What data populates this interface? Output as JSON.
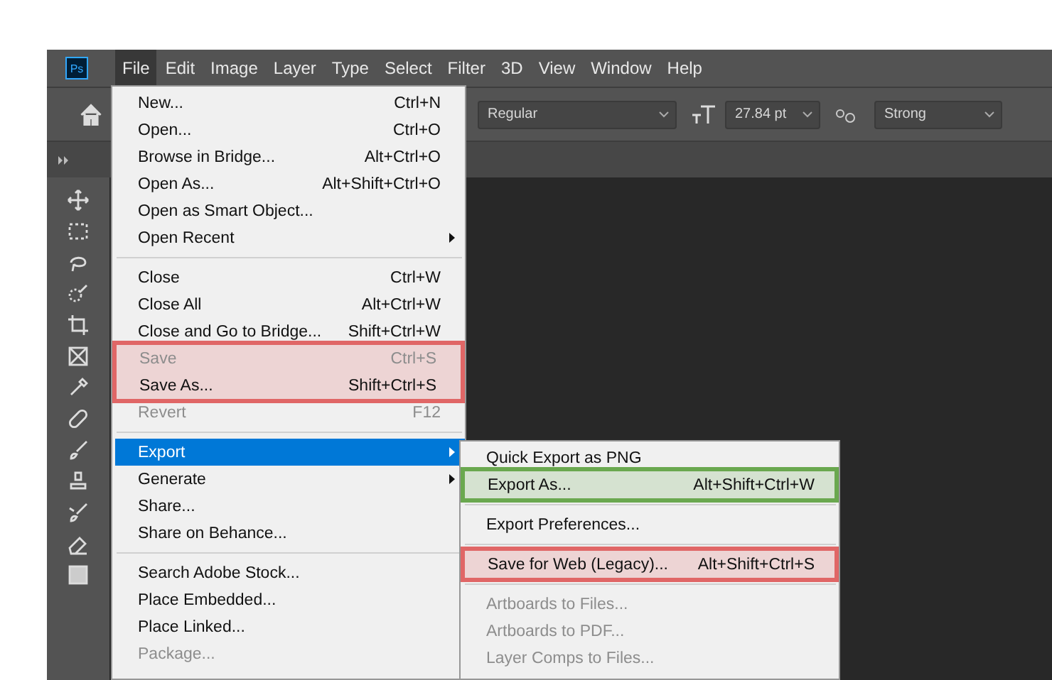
{
  "app": {
    "logo": "Ps"
  },
  "menu_bar": [
    {
      "label": "File",
      "selected": true
    },
    {
      "label": "Edit",
      "selected": false
    },
    {
      "label": "Image",
      "selected": false
    },
    {
      "label": "Layer",
      "selected": false
    },
    {
      "label": "Type",
      "selected": false
    },
    {
      "label": "Select",
      "selected": false
    },
    {
      "label": "Filter",
      "selected": false
    },
    {
      "label": "3D",
      "selected": false
    },
    {
      "label": "View",
      "selected": false
    },
    {
      "label": "Window",
      "selected": false
    },
    {
      "label": "Help",
      "selected": false
    }
  ],
  "options_bar": {
    "font_style": "Regular",
    "font_size": "27.84 pt",
    "anti_alias": "Strong"
  },
  "file_menu": {
    "sections": [
      {
        "items": [
          {
            "label": "New...",
            "shortcut": "Ctrl+N",
            "disabled": false,
            "selected": false,
            "submenu": false
          },
          {
            "label": "Open...",
            "shortcut": "Ctrl+O",
            "disabled": false,
            "selected": false,
            "submenu": false
          },
          {
            "label": "Browse in Bridge...",
            "shortcut": "Alt+Ctrl+O",
            "disabled": false,
            "selected": false,
            "submenu": false
          },
          {
            "label": "Open As...",
            "shortcut": "Alt+Shift+Ctrl+O",
            "disabled": false,
            "selected": false,
            "submenu": false
          },
          {
            "label": "Open as Smart Object...",
            "disabled": false,
            "selected": false,
            "submenu": false
          },
          {
            "label": "Open Recent",
            "disabled": false,
            "selected": false,
            "submenu": true
          }
        ]
      },
      {
        "items": [
          {
            "label": "Close",
            "shortcut": "Ctrl+W",
            "disabled": false,
            "selected": false,
            "submenu": false
          },
          {
            "label": "Close All",
            "shortcut": "Alt+Ctrl+W",
            "disabled": false,
            "selected": false,
            "submenu": false
          },
          {
            "label": "Close and Go to Bridge...",
            "shortcut": "Shift+Ctrl+W",
            "disabled": false,
            "selected": false,
            "submenu": false
          },
          {
            "label": "Save",
            "shortcut": "Ctrl+S",
            "disabled": true,
            "selected": false,
            "submenu": false,
            "color": "#e06666"
          },
          {
            "label": "Save As...",
            "shortcut": "Shift+Ctrl+S",
            "disabled": false,
            "selected": false,
            "submenu": false,
            "color": "#e06666"
          },
          {
            "label": "Revert",
            "shortcut": "F12",
            "disabled": true,
            "selected": false,
            "submenu": false
          }
        ]
      },
      {
        "items": [
          {
            "label": "Export",
            "disabled": false,
            "selected": true,
            "submenu": true
          },
          {
            "label": "Generate",
            "disabled": false,
            "selected": false,
            "submenu": true
          },
          {
            "label": "Share...",
            "disabled": false,
            "selected": false,
            "submenu": false
          },
          {
            "label": "Share on Behance...",
            "disabled": false,
            "selected": false,
            "submenu": false
          }
        ]
      },
      {
        "items": [
          {
            "label": "Search Adobe Stock...",
            "disabled": false,
            "selected": false,
            "submenu": false
          },
          {
            "label": "Place Embedded...",
            "disabled": false,
            "selected": false,
            "submenu": false
          },
          {
            "label": "Place Linked...",
            "disabled": false,
            "selected": false,
            "submenu": false
          },
          {
            "label": "Package...",
            "disabled": true,
            "selected": false,
            "submenu": false
          }
        ]
      }
    ]
  },
  "export_submenu": {
    "sections": [
      {
        "items": [
          {
            "label": "Quick Export as PNG",
            "disabled": false,
            "selected": false,
            "submenu": false
          },
          {
            "label": "Export As...",
            "shortcut": "Alt+Shift+Ctrl+W",
            "disabled": false,
            "selected": false,
            "submenu": false,
            "color": "#6aa84f"
          }
        ]
      },
      {
        "items": [
          {
            "label": "Export Preferences...",
            "disabled": false,
            "selected": false,
            "submenu": false
          }
        ]
      },
      {
        "items": [
          {
            "label": "Save for Web (Legacy)...",
            "shortcut": "Alt+Shift+Ctrl+S",
            "disabled": false,
            "selected": false,
            "submenu": false,
            "color": "#e06666"
          }
        ]
      },
      {
        "items": [
          {
            "label": "Artboards to Files...",
            "disabled": true,
            "selected": false,
            "submenu": false
          },
          {
            "label": "Artboards to PDF...",
            "disabled": true,
            "selected": false,
            "submenu": false
          },
          {
            "label": "Layer Comps to Files...",
            "disabled": true,
            "selected": false,
            "submenu": false
          }
        ]
      }
    ]
  }
}
